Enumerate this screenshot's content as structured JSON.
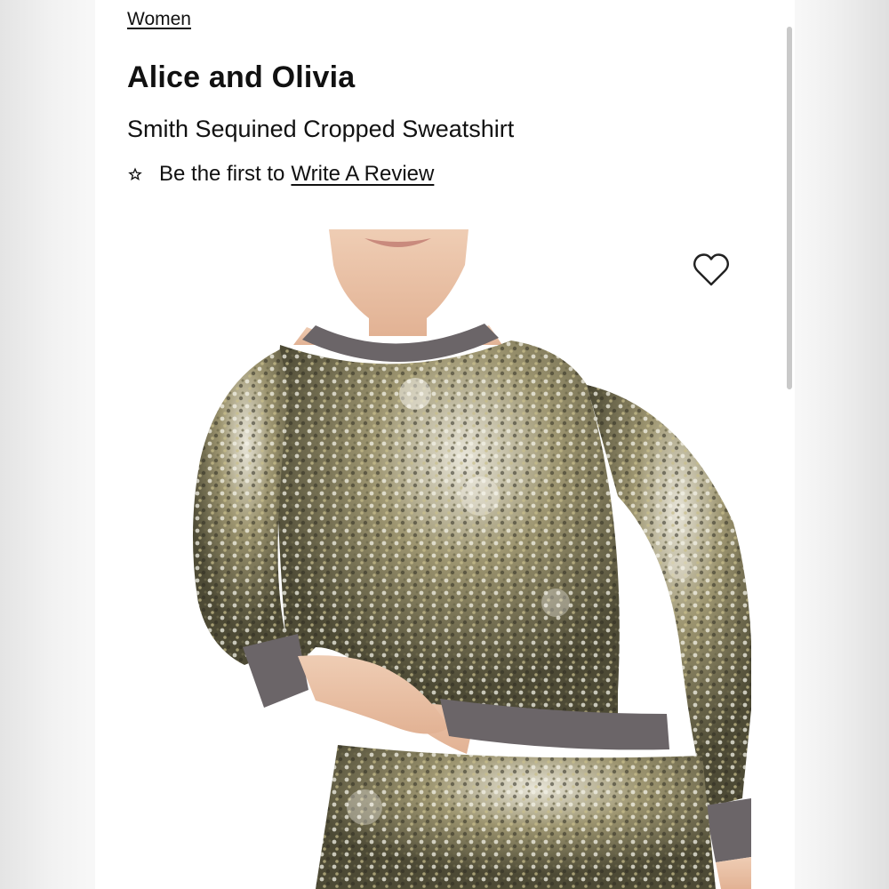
{
  "breadcrumb": {
    "label": "Women"
  },
  "product": {
    "brand": "Alice and Olivia",
    "name": "Smith Sequined Cropped Sweatshirt"
  },
  "reviews": {
    "prompt": "Be the first to",
    "link_label": "Write A Review",
    "icon": "star-icon"
  },
  "wishlist": {
    "icon": "heart-outline-icon"
  },
  "image": {
    "subject": "sequined cropped sweatshirt on model",
    "colors": {
      "sequin_gold": "#b9ad7c",
      "sequin_olive": "#5f5b3d",
      "sequin_silver": "#d8d6cf",
      "rib_trim": "#6b6568",
      "skin": "#e9c2a6"
    }
  },
  "colors": {
    "text": "#111111",
    "page_bg": "#ffffff",
    "outer_bg": "#f4f4f4",
    "scrollbar": "#c9c9c9"
  }
}
